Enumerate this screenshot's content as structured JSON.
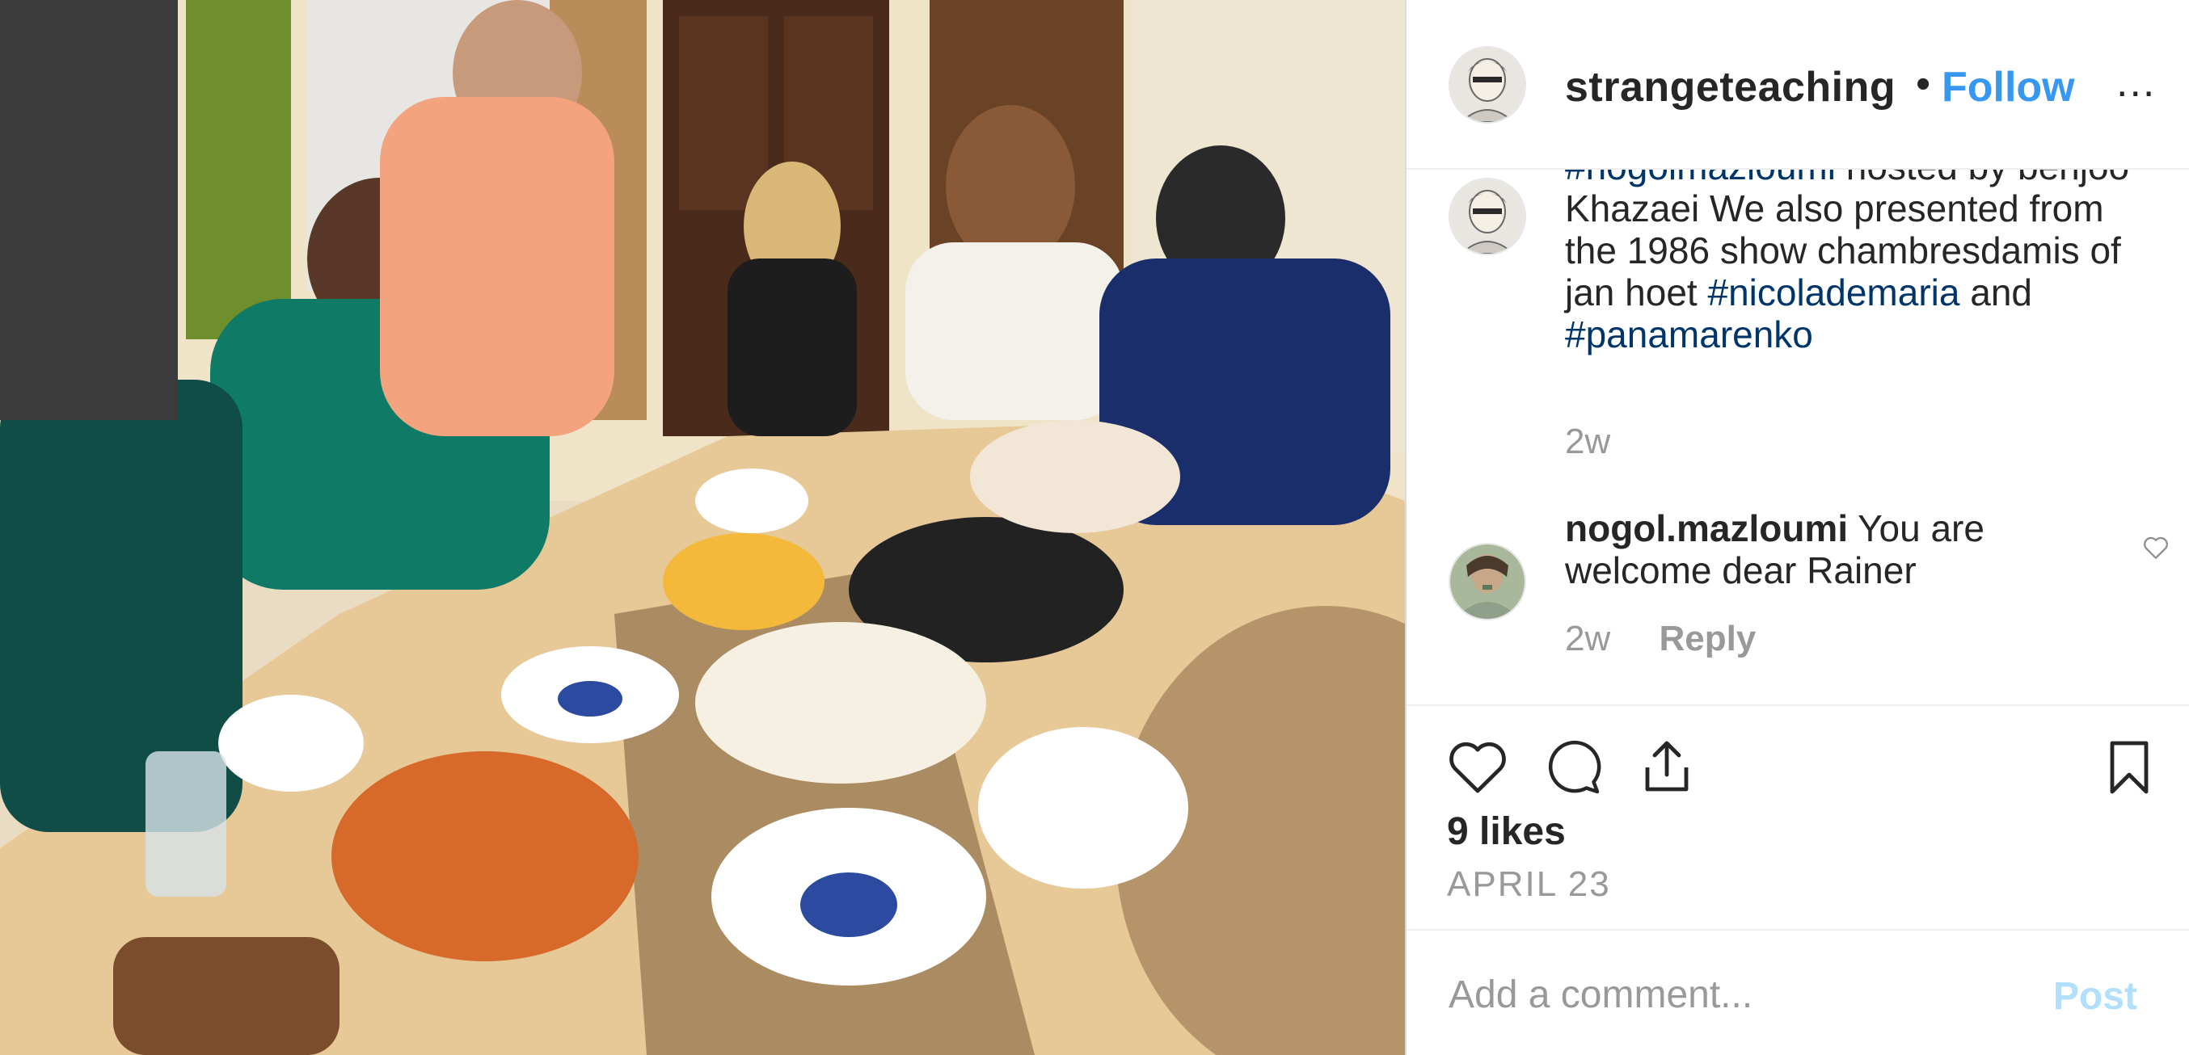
{
  "post": {
    "username": "strangeteaching",
    "follow_label": "Follow",
    "separator": "•",
    "more_label": "...",
    "caption_parts": [
      {
        "text": "#nogolmazloumi",
        "hashtag": true
      },
      {
        "text": " hosted by behjoo Khazaei We also presented from the 1986 show chambresdamis of jan hoet ",
        "hashtag": false
      },
      {
        "text": "#nicolademaria",
        "hashtag": true
      },
      {
        "text": " and ",
        "hashtag": false
      },
      {
        "text": "#panamarenko",
        "hashtag": true
      }
    ],
    "caption_time": "2w"
  },
  "comment": {
    "username": "nogol.mazloumi",
    "text": "You are welcome dear Rainer",
    "time": "2w",
    "reply_label": "Reply"
  },
  "actions": {
    "like_icon": "heart-icon",
    "comment_icon": "comment-icon",
    "share_icon": "share-icon",
    "save_icon": "bookmark-icon",
    "likes": "9 likes",
    "date": "APRIL 23"
  },
  "add_comment": {
    "placeholder": "Add a comment...",
    "post_label": "Post"
  },
  "colors": {
    "link_blue": "#3897f0",
    "hashtag": "#003569",
    "muted": "#999999",
    "post_disabled": "#b2dffc"
  }
}
